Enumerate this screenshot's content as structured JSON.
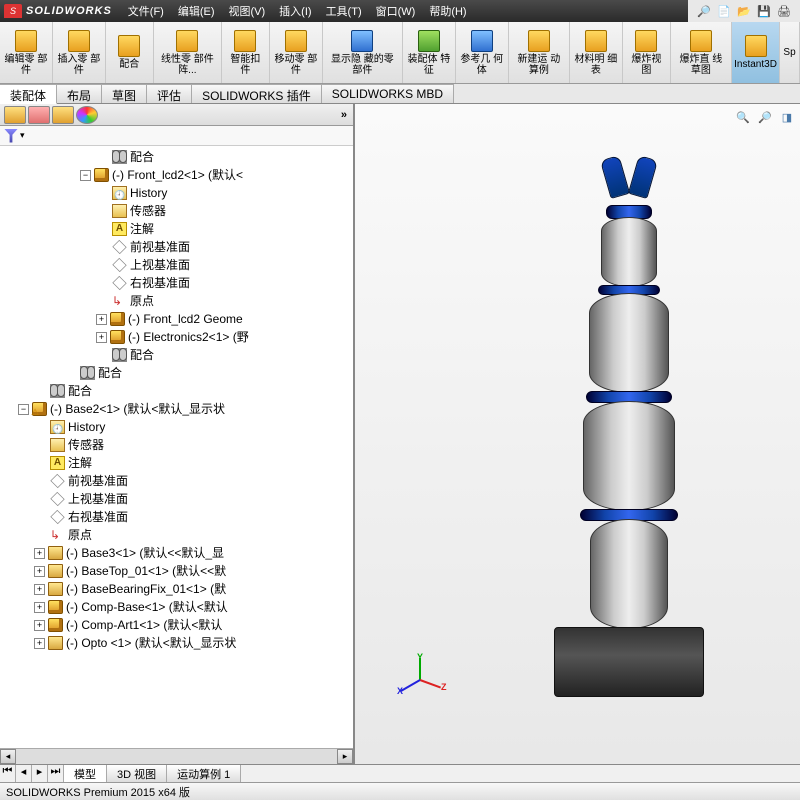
{
  "title": {
    "brand": "SOLIDWORKS"
  },
  "menu": {
    "file": "文件(F)",
    "edit": "编辑(E)",
    "view": "视图(V)",
    "insert": "插入(I)",
    "tools": "工具(T)",
    "window": "窗口(W)",
    "help": "帮助(H)"
  },
  "ribbon": {
    "edit_part": "编辑零\n部件",
    "insert_part": "插入零\n部件",
    "mate": "配合",
    "linear_pattern": "线性零\n部件阵...",
    "smart_fastener": "智能扣\n件",
    "move_part": "移动零\n部件",
    "show_hidden": "显示隐\n藏的零\n部件",
    "asm_feature": "装配体\n特征",
    "ref_geom": "参考几\n何体",
    "new_motion": "新建运\n动算例",
    "bom": "材料明\n细表",
    "exploded": "爆炸视\n图",
    "explode_line": "爆炸直\n线草图",
    "instant3d": "Instant3D",
    "sp": "Sp"
  },
  "tabs": {
    "assembly": "装配体",
    "layout": "布局",
    "sketch": "草图",
    "evaluate": "评估",
    "addins": "SOLIDWORKS 插件",
    "mbd": "SOLIDWORKS MBD"
  },
  "tree": {
    "mate": "配合",
    "front_lcd2": "(-) Front_lcd2<1> (默认<",
    "history": "History",
    "sensors": "传感器",
    "annotations": "注解",
    "front_plane": "前视基准面",
    "top_plane": "上视基准面",
    "right_plane": "右视基准面",
    "origin": "原点",
    "front_lcd2_geom": "(-) Front_lcd2 Geome",
    "electronics2": "(-) Electronics2<1> (野",
    "base2": "(-) Base2<1> (默认<默认_显示状",
    "base3": "(-) Base3<1> (默认<<默认_显",
    "basetop": "(-) BaseTop_01<1> (默认<<默",
    "basebearing": "(-) BaseBearingFix_01<1> (默",
    "compbase": "(-) Comp-Base<1> (默认<默认",
    "compart": "(-) Comp-Art1<1> (默认<默认",
    "opto": "(-) Opto <1> (默认<默认_显示状"
  },
  "bottom_tabs": {
    "model": "模型",
    "view3d": "3D 视图",
    "motion": "运动算例 1"
  },
  "status": {
    "text": "SOLIDWORKS Premium 2015 x64 版"
  },
  "triad": {
    "x": "X",
    "y": "Y",
    "z": "Z"
  }
}
